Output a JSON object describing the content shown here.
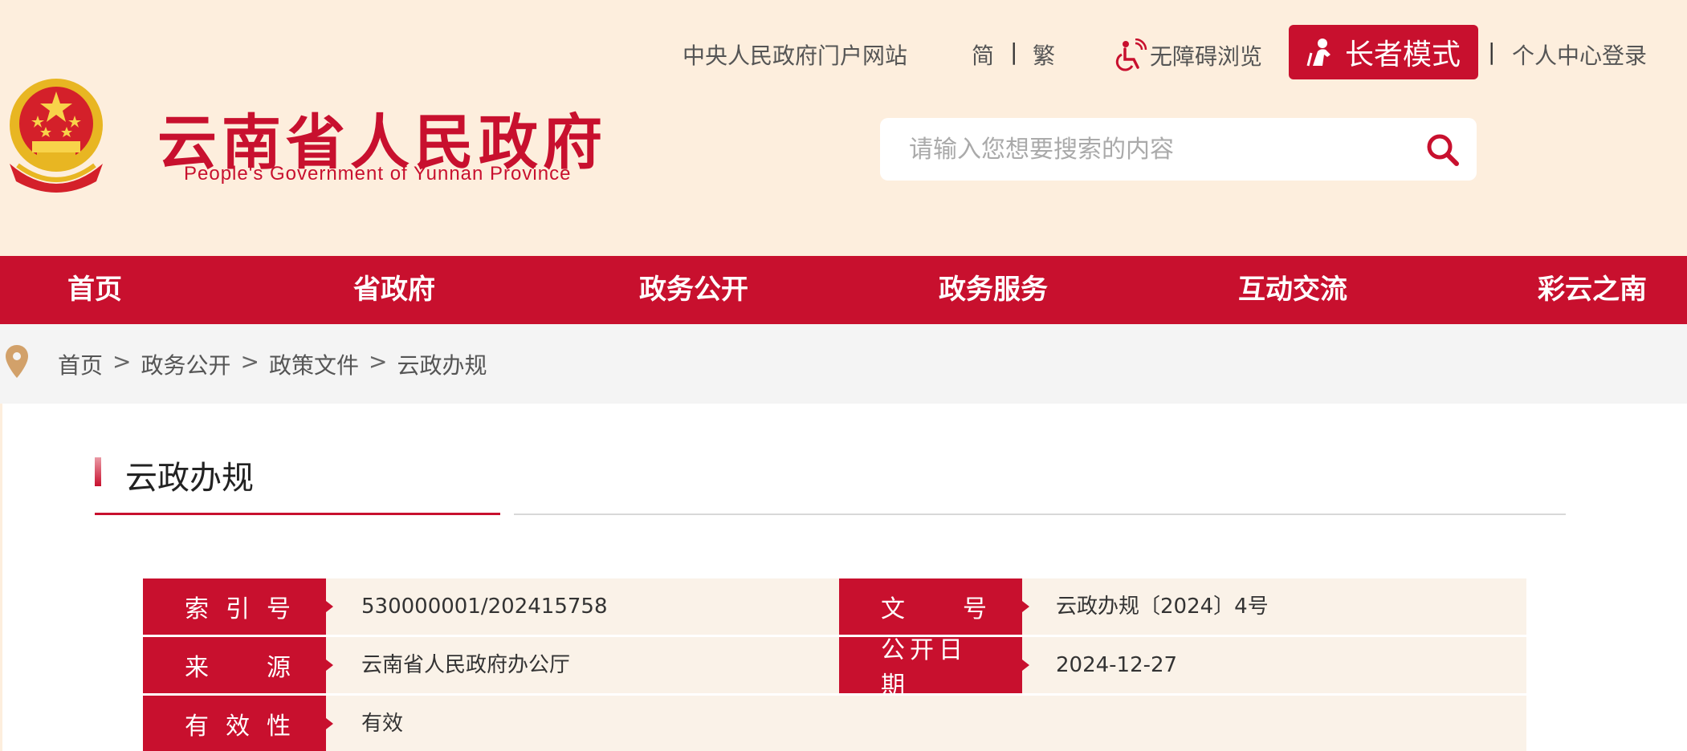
{
  "header": {
    "title": "云南省人民政府",
    "subtitle": "People's Government of Yunnan Province",
    "links": {
      "portal": "中央人民政府门户网站",
      "simplified": "简",
      "separator": "|",
      "traditional": "繁",
      "accessibility": "无障碍浏览",
      "elder_mode": "长者模式",
      "login": "个人中心登录"
    },
    "search": {
      "placeholder": "请输入您想要搜索的内容",
      "icon": "search-icon"
    }
  },
  "nav": {
    "items": [
      {
        "label": "首页"
      },
      {
        "label": "省政府"
      },
      {
        "label": "政务公开"
      },
      {
        "label": "政务服务"
      },
      {
        "label": "互动交流"
      },
      {
        "label": "彩云之南"
      }
    ]
  },
  "breadcrumb": {
    "icon": "location-pin-icon",
    "items": [
      "首页",
      "政务公开",
      "政策文件",
      "云政办规"
    ],
    "separator": ">"
  },
  "section": {
    "title": "云政办规"
  },
  "info": {
    "index_label": [
      "索",
      "引",
      "号"
    ],
    "index_value": "530000001/202415758",
    "docno_label": [
      "文",
      "号"
    ],
    "docno_value": "云政办规〔2024〕4号",
    "source_label": [
      "来",
      "源"
    ],
    "source_value": "云南省人民政府办公厅",
    "date_label": "公开日期",
    "date_value": "2024-12-27",
    "validity_label": [
      "有",
      "效",
      "性"
    ],
    "validity_value": "有效"
  },
  "colors": {
    "brand_red": "#c8102e",
    "header_bg": "#fdeedd",
    "row_bg": "#faf2e8"
  }
}
